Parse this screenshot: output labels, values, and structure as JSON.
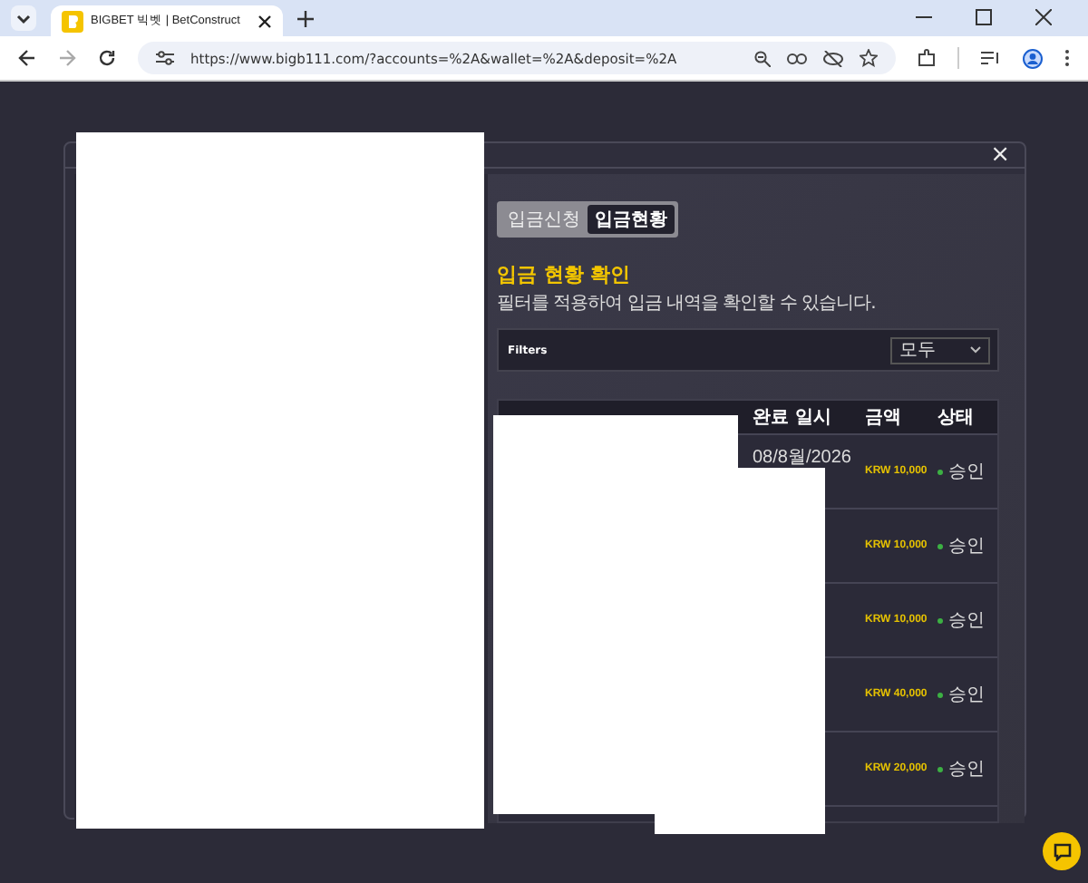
{
  "browser": {
    "tab_title": "BIGBET 빅벳 | BetConstruct",
    "url": "https://www.bigb111.com/?accounts=%2A&wallet=%2A&deposit=%2A"
  },
  "modal": {
    "close": "×",
    "tabs": [
      {
        "label": "입금신청",
        "selected": false
      },
      {
        "label": "입금현황",
        "selected": true
      }
    ],
    "heading": "입금 현황 확인",
    "subtitle": "필터를 적용하여 입금 내역을 확인할 수 있습니다.",
    "filters": {
      "label": "Filters",
      "dropdown": "모두"
    },
    "table": {
      "columns": [
        "",
        "",
        "",
        "완료 일시",
        "금액",
        "상태"
      ],
      "rows": [
        {
          "completed": "08/8월/2026",
          "amount": "KRW 10,000",
          "status": "승인"
        },
        {
          "completed": "",
          "amount": "KRW 10,000",
          "status": "승인"
        },
        {
          "completed": "",
          "amount": "KRW 10,000",
          "status": "승인"
        },
        {
          "completed": "",
          "amount": "KRW 40,000",
          "status": "승인"
        },
        {
          "completed": "",
          "amount": "KRW 20,000",
          "status": "승인"
        }
      ]
    }
  },
  "redactions": [
    {
      "kind": "redaction"
    },
    {
      "kind": "redaction"
    },
    {
      "kind": "redaction"
    },
    {
      "kind": "redaction"
    }
  ]
}
